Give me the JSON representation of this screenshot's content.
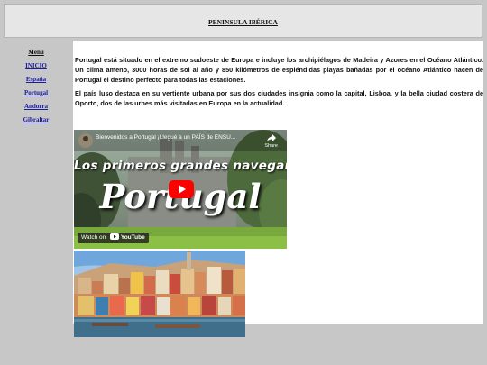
{
  "header": {
    "title": "PENINSULA IBÉRICA"
  },
  "sidebar": {
    "title": "Menú",
    "items": [
      {
        "label": "INICIO"
      },
      {
        "label": "España"
      },
      {
        "label": "Portugal"
      },
      {
        "label": "Andorra"
      },
      {
        "label": "Gibraltar"
      }
    ]
  },
  "content": {
    "paragraphs": [
      "Portugal está situado en el extremo sudoeste de Europa e incluye los archipiélagos de Madeira y Azores en el Océano Atlántico. Un clima ameno, 3000 horas de sol al año y 850 kilómetros de espléndidas playas bañadas por el océano Atlántico hacen de Portugal el destino perfecto para todas las estaciones.",
      "El país luso destaca en su vertiente urbana por sus dos ciudades insignia como la capital, Lisboa, y la bella ciudad costera de Oporto, dos de las urbes más visitadas en Europa en la actualidad."
    ]
  },
  "video": {
    "title": "Bienvenidos a Portugal ¡Llegué a un PAÍS de ENSU...",
    "share_label": "Share",
    "headline": "Los primeros grandes navegantes",
    "big_text": "Portugal",
    "watch_on": "Watch on",
    "platform": "YouTube"
  },
  "colors": {
    "page_bg": "#c7c7c7",
    "header_bg": "#e6e6e6",
    "link": "#1a1aa6",
    "youtube_red": "#ff0000"
  }
}
